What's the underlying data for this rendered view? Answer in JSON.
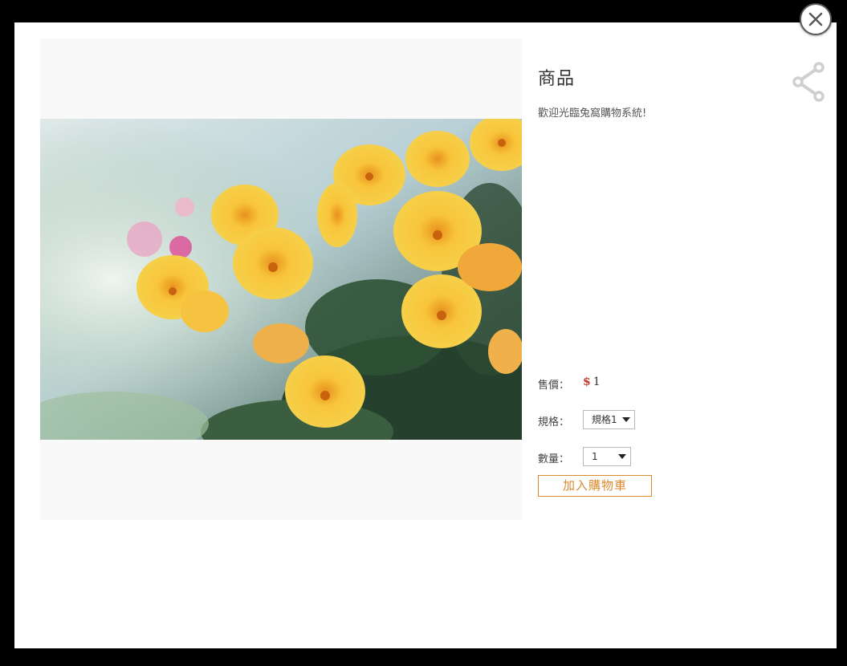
{
  "product": {
    "title": "商品",
    "description": "歡迎光臨兔窩購物系統!",
    "image_alt": "yellow pansy flowers"
  },
  "price": {
    "label": "售價：",
    "currency": "$",
    "amount": "1"
  },
  "spec": {
    "label": "規格：",
    "selected": "規格1"
  },
  "quantity": {
    "label": "數量：",
    "selected": "1"
  },
  "actions": {
    "add_to_cart_label": "加入購物車"
  },
  "icons": {
    "share": "share-icon",
    "close": "close-icon"
  },
  "colors": {
    "accent": "#d98a2b",
    "price_currency": "#c0392b",
    "backdrop": "#000000"
  }
}
